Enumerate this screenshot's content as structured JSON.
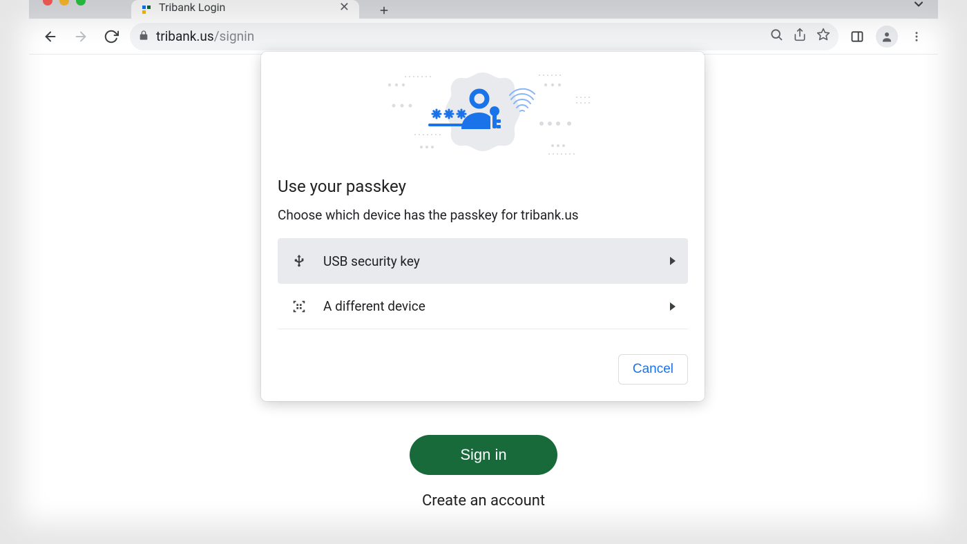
{
  "tab": {
    "title": "Tribank Login"
  },
  "toolbar": {
    "url_host": "tribank.us",
    "url_path": "/signin"
  },
  "page": {
    "signin_label": "Sign in",
    "create_account_label": "Create an account"
  },
  "dialog": {
    "title": "Use your passkey",
    "subtitle": "Choose which device has the passkey for tribank.us",
    "options": [
      {
        "label": "USB security key"
      },
      {
        "label": "A different device"
      }
    ],
    "cancel_label": "Cancel"
  }
}
